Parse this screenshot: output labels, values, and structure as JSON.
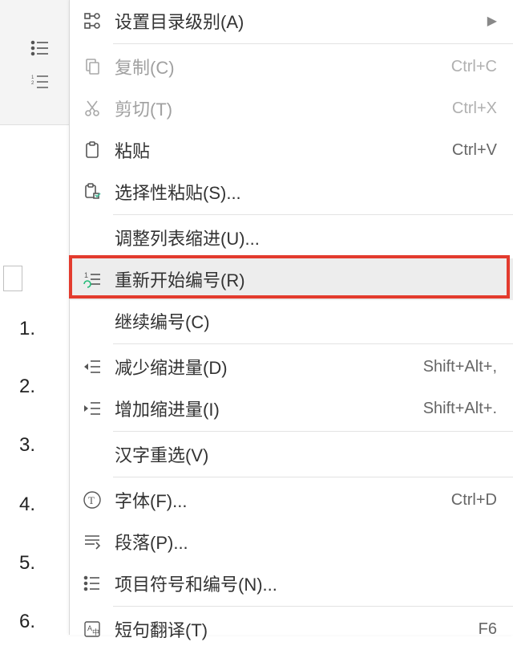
{
  "document_numbers": [
    "1.",
    "2.",
    "3.",
    "4.",
    "5.",
    "6."
  ],
  "menu": {
    "set_toc_level": "设置目录级别(A)",
    "copy": "复制(C)",
    "copy_key": "Ctrl+C",
    "cut": "剪切(T)",
    "cut_key": "Ctrl+X",
    "paste": "粘贴",
    "paste_key": "Ctrl+V",
    "paste_special": "选择性粘贴(S)...",
    "adjust_indent": "调整列表缩进(U)...",
    "restart_numbering": "重新开始编号(R)",
    "continue_numbering": "继续编号(C)",
    "decrease_indent": "减少缩进量(D)",
    "decrease_key": "Shift+Alt+,",
    "increase_indent": "增加缩进量(I)",
    "increase_key": "Shift+Alt+.",
    "cn_reselect": "汉字重选(V)",
    "font": "字体(F)...",
    "font_key": "Ctrl+D",
    "paragraph": "段落(P)...",
    "bullets_numbering": "项目符号和编号(N)...",
    "phrase_translate": "短句翻译(T)",
    "phrase_key": "F6"
  }
}
